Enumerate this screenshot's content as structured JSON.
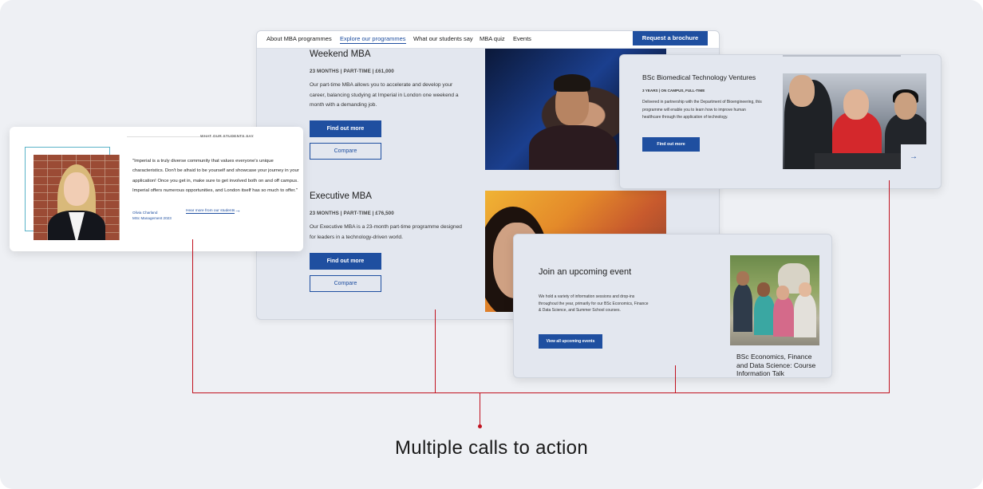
{
  "nav": {
    "links": [
      "About MBA programmes",
      "Explore our programmes",
      "What our students say",
      "MBA quiz",
      "Events"
    ],
    "cta": "Request a brochure"
  },
  "programmes": [
    {
      "title": "Weekend MBA",
      "meta": "23 MONTHS   |  PART-TIME   |  £61,000",
      "description": "Our part-time MBA allows you to accelerate and develop your career, balancing studying at Imperial in London one weekend a month with a demanding job.",
      "primary_cta": "Find out more",
      "secondary_cta": "Compare"
    },
    {
      "title": "Executive MBA",
      "meta": "23 MONTHS   |  PART-TIME   |  £76,500",
      "description": "Our Executive MBA is a 23-month part-time programme designed for leaders in a technology-driven world.",
      "primary_cta": "Find out more",
      "secondary_cta": "Compare"
    }
  ],
  "testimonial": {
    "header": "WHAT OUR STUDENTS SAY",
    "quote": "\"Imperial is a truly diverse community that values everyone's unique characteristics. Don't be afraid to be yourself and showcase your journey in your application! Once you get in, make sure to get involved both on and off campus. Imperial offers numerous opportunities, and London itself has so much to offer.\"",
    "name": "Olivia Charland",
    "programme": "MSc Management 2023",
    "link": "Hear more from our students"
  },
  "biomedical": {
    "title": "BSc Biomedical Technology Ventures",
    "meta": "3 YEARS   |  ON CAMPUS, FULL-TIME",
    "description": "Delivered in partnership with the Department of Bioengineering, this programme will enable you to learn how to improve human healthcare through the application of technology.",
    "cta": "Find out more"
  },
  "events": {
    "title": "Join an upcoming event",
    "description": "We hold a variety of information sessions and drop-ins throughout the year, primarily for our BSc Economics, Finance & Data Science, and Summer School courses.",
    "cta": "View all upcoming events",
    "caption": "BSc Economics, Finance and Data Science: Course Information Talk"
  },
  "caption": "Multiple calls to action",
  "colors": {
    "brand_blue": "#1f4fa0",
    "connector_red": "#c1121f"
  },
  "icons": {
    "arrow": "→"
  }
}
